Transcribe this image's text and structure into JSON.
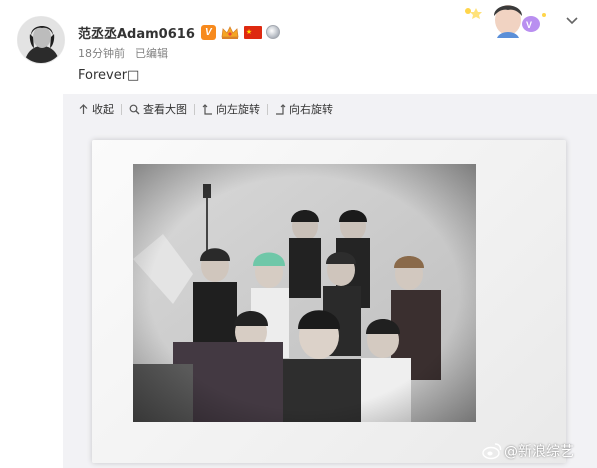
{
  "post": {
    "username": "范丞丞Adam0616",
    "badges": [
      {
        "name": "verified-v-badge",
        "text": "V",
        "color": "#f78a1d"
      },
      {
        "name": "crown-badge-icon",
        "text": ""
      },
      {
        "name": "china-flag-icon",
        "text": "★"
      },
      {
        "name": "medal-badge-icon",
        "text": ""
      }
    ],
    "time": "18分钟前",
    "edited": "已编辑",
    "text": "Forever□"
  },
  "toolbar": {
    "collapse": "收起",
    "view_large": "查看大图",
    "rotate_left": "向左旋转",
    "rotate_right": "向右旋转"
  },
  "watermark": {
    "text": "@新浪综艺"
  },
  "colors": {
    "text": "#333333",
    "meta": "#808080",
    "accent_orange": "#f78a1d",
    "panel_bg": "#f2f2f5"
  }
}
